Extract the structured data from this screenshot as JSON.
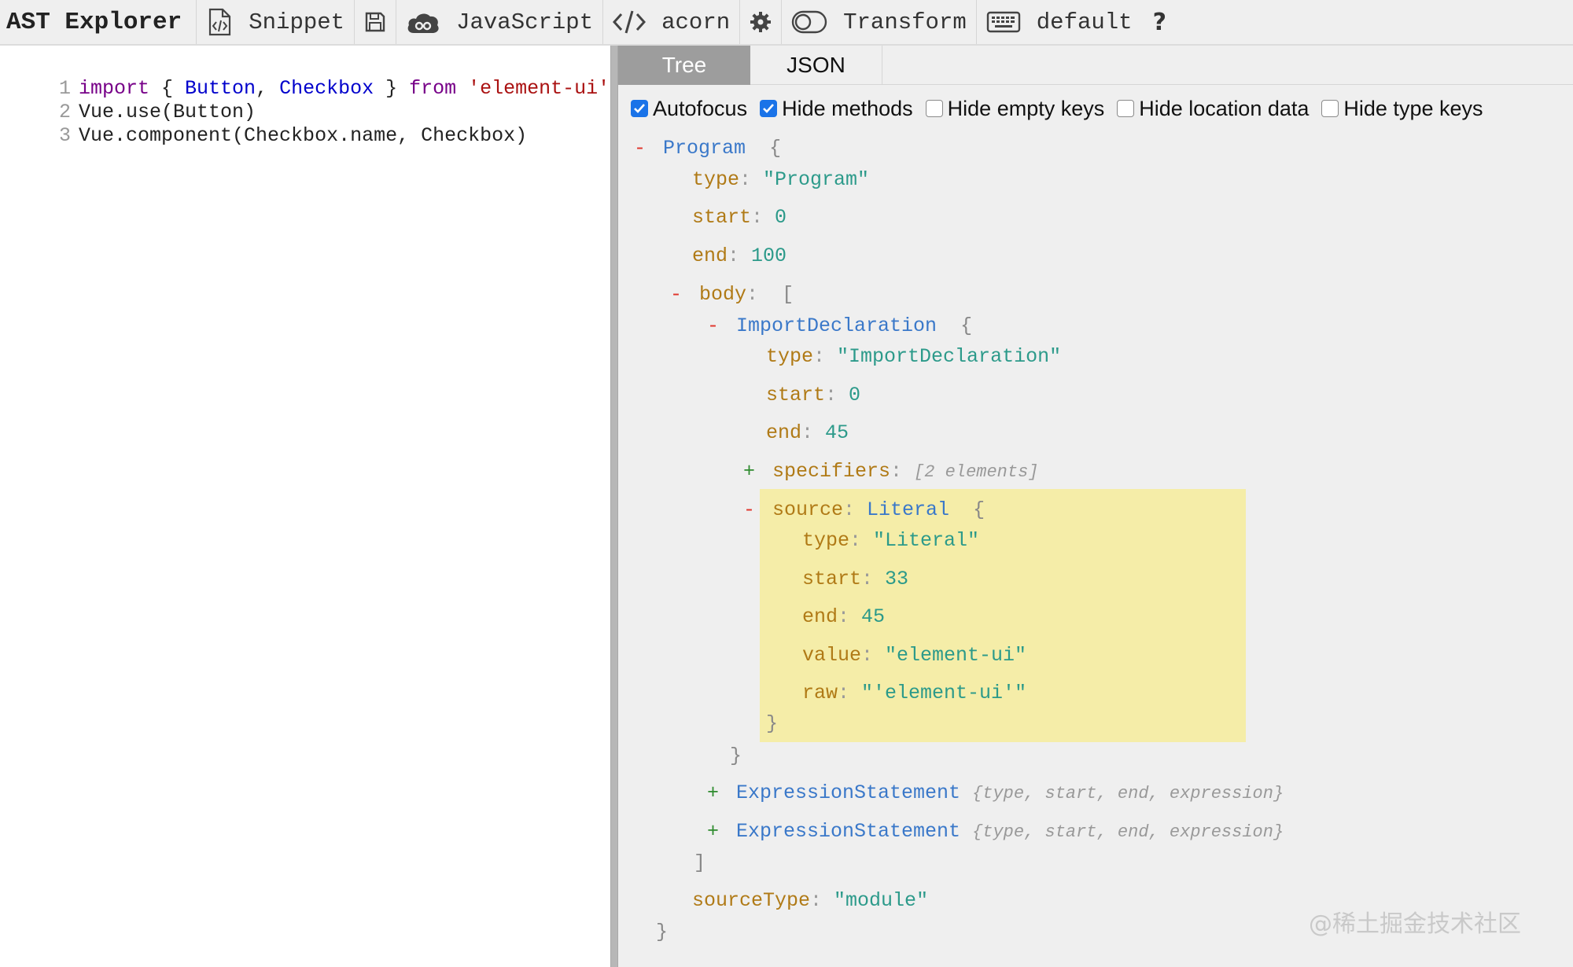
{
  "toolbar": {
    "app_title": "AST Explorer",
    "snippet_label": "Snippet",
    "language_label": "JavaScript",
    "parser_label": "acorn",
    "transform_label": "Transform",
    "keymap_label": "default",
    "help_label": "?",
    "icons": [
      "snippet-file-icon",
      "save-icon",
      "language-cloud-icon",
      "code-brackets-icon",
      "gear-icon",
      "toggle-icon",
      "keyboard-icon"
    ]
  },
  "editor": {
    "lines": [
      {
        "number": "1",
        "tokens": [
          {
            "text": "import",
            "kind": "kw"
          },
          {
            "text": " { ",
            "kind": "plain"
          },
          {
            "text": "Button",
            "kind": "def"
          },
          {
            "text": ", ",
            "kind": "plain"
          },
          {
            "text": "Checkbox",
            "kind": "def"
          },
          {
            "text": " } ",
            "kind": "plain"
          },
          {
            "text": "from",
            "kind": "kw"
          },
          {
            "text": " ",
            "kind": "plain"
          },
          {
            "text": "'element-ui'",
            "kind": "str"
          }
        ]
      },
      {
        "number": "2",
        "tokens": [
          {
            "text": "Vue.use(Button)",
            "kind": "plain"
          }
        ]
      },
      {
        "number": "3",
        "tokens": [
          {
            "text": "Vue.component(Checkbox.name, Checkbox)",
            "kind": "plain"
          }
        ]
      }
    ]
  },
  "output": {
    "tabs": [
      {
        "label": "Tree",
        "active": true
      },
      {
        "label": "JSON",
        "active": false
      }
    ],
    "options": [
      {
        "label": "Autofocus",
        "checked": true
      },
      {
        "label": "Hide methods",
        "checked": true
      },
      {
        "label": "Hide empty keys",
        "checked": false
      },
      {
        "label": "Hide location data",
        "checked": false
      },
      {
        "label": "Hide type keys",
        "checked": false
      }
    ],
    "tree": {
      "program_node": "Program",
      "program_type": "\"Program\"",
      "program_start": "0",
      "program_end": "100",
      "body_key": "body",
      "import_node": "ImportDeclaration",
      "import_type": "\"ImportDeclaration\"",
      "import_start": "0",
      "import_end": "45",
      "specifiers_key": "specifiers",
      "specifiers_summary": "[2 elements]",
      "source_key": "source",
      "source_node": "Literal",
      "literal_type": "\"Literal\"",
      "literal_start": "33",
      "literal_end": "45",
      "literal_value": "\"element-ui\"",
      "literal_raw": "\"'element-ui'\"",
      "expression_node": "ExpressionStatement",
      "expression_summary": "{type, start, end, expression}",
      "source_type_key": "sourceType",
      "source_type_value": "\"module\""
    }
  },
  "watermark": "@稀土掘金技术社区",
  "colors": {
    "toolbar_bg": "#efefef",
    "panel_bg": "#efefef",
    "active_tab": "#9d9d9d",
    "checkbox_blue": "#1a73e8",
    "highlight": "#f5eda8",
    "node_type": "#3a78c9",
    "key": "#b07a16",
    "value": "#2c9a8a",
    "collapse_toggle": "#e0342b",
    "expand_toggle": "#2e8b2e"
  }
}
